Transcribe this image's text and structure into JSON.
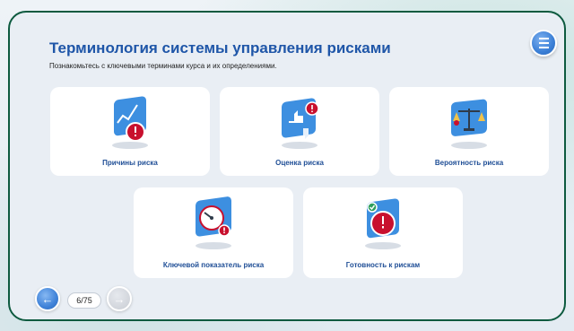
{
  "header": {
    "title": "Терминология системы управления рисками",
    "subtitle": "Познакомьтесь с ключевыми терминами курса и их определениями."
  },
  "menu": {
    "icon": "hamburger-menu-icon"
  },
  "cards": [
    {
      "label": "Причины риска",
      "icon": "chart-warning-icon"
    },
    {
      "label": "Оценка риска",
      "icon": "thumbs-rating-icon"
    },
    {
      "label": "Вероятность риска",
      "icon": "balance-scale-icon"
    },
    {
      "label": "Ключевой показатель риска",
      "icon": "gauge-icon"
    },
    {
      "label": "Готовность к рискам",
      "icon": "shield-check-icon"
    }
  ],
  "navigation": {
    "prev_icon": "arrow-left-icon",
    "next_icon": "arrow-right-icon",
    "page_counter": "6/75"
  },
  "colors": {
    "accent": "#1f56a8",
    "frame": "#0d5a3f",
    "icon_blue": "#3d8fe0",
    "warning_red": "#c8102e"
  }
}
